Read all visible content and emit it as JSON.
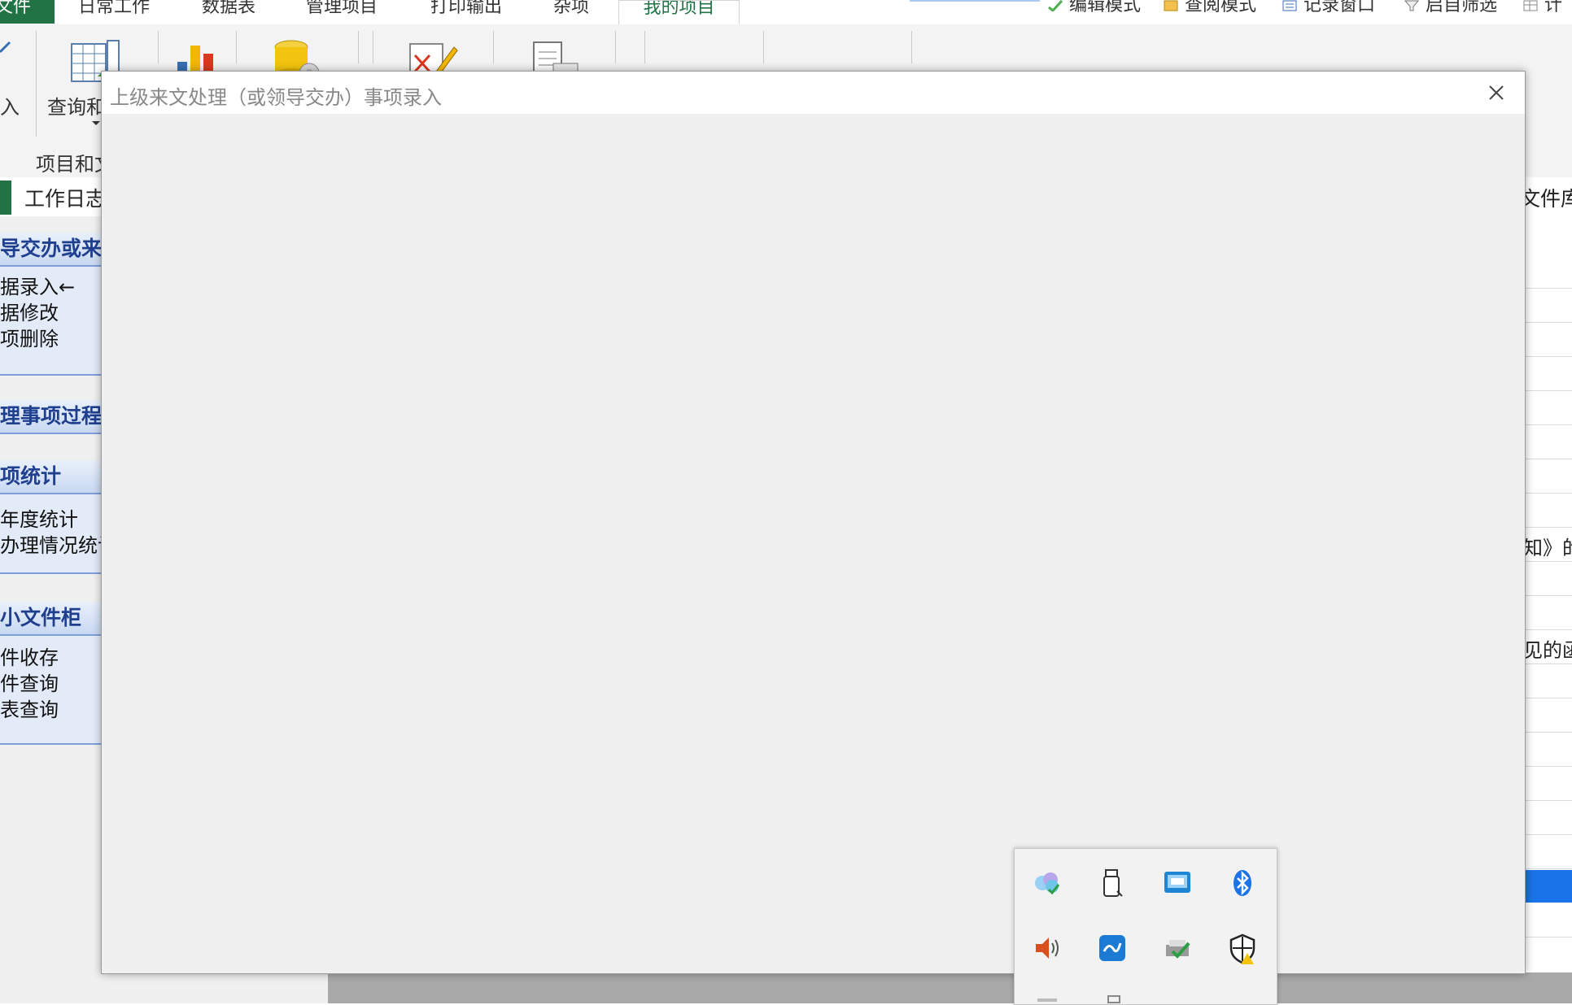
{
  "ribbon_tabs": [
    {
      "label": "文件"
    },
    {
      "label": "日常工作"
    },
    {
      "label": "数据表"
    },
    {
      "label": "管理项目"
    },
    {
      "label": "打印输出"
    },
    {
      "label": "杂项"
    },
    {
      "label": "我的项目"
    }
  ],
  "quick_access": [
    {
      "label": "编辑模式",
      "icon": "edit-mode-icon"
    },
    {
      "label": "查阅模式",
      "icon": "view-mode-icon"
    },
    {
      "label": "记录窗口",
      "icon": "record-window-icon"
    },
    {
      "label": "启自筛选",
      "icon": "filter-icon"
    },
    {
      "label": "计",
      "icon": "table-icon"
    }
  ],
  "ribbon": {
    "btn_input_label": "入",
    "btn_query_label": "查询和",
    "group_label": "项目和文"
  },
  "doc_tabs": {
    "left_label": "工作日志",
    "right_label": "文件库"
  },
  "left_panel": {
    "groups": [
      {
        "title": "导交办或来文",
        "items": [
          "据录入←",
          "据修改",
          "项删除"
        ]
      },
      {
        "title": "理事项过程者",
        "items": []
      },
      {
        "title": "项统计",
        "items": [
          "年度统计",
          "办理情况统计"
        ]
      },
      {
        "title": "小文件柜",
        "items": [
          "件收存",
          "件查询",
          "表查询"
        ]
      }
    ]
  },
  "right_grid": {
    "text_1": "知》的",
    "text_2": "见的函"
  },
  "modal": {
    "title": "上级来文处理（或领导交办）事项录入"
  },
  "colors": {
    "accent_green": "#217346",
    "panel_blue": "#1f3f8f",
    "selection_blue": "#1a73e8"
  },
  "tray_icons": [
    "cloud-sync-icon",
    "usb-drive-icon",
    "network-monitor-icon",
    "bluetooth-icon",
    "volume-icon",
    "wave-app-icon",
    "print-check-icon",
    "security-shield-icon"
  ]
}
